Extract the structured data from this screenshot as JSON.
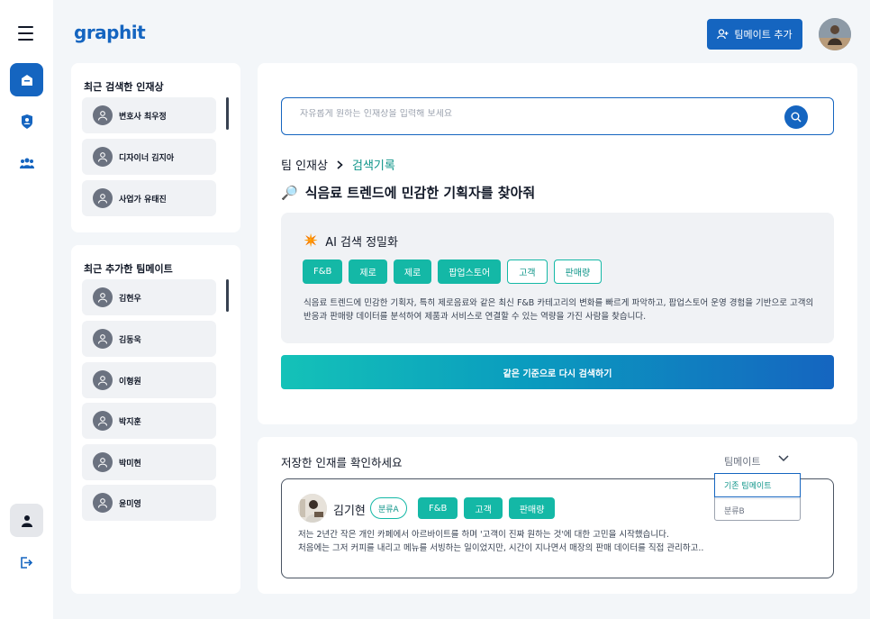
{
  "header": {
    "logo": "graphit",
    "add_teammate_label": "팀메이트 추가"
  },
  "sidebar": {
    "recent_searches_title": "최근 검색한 인재상",
    "recent_searches": [
      "변호사 최우정",
      "디자이너 김지아",
      "사업가 유태진"
    ],
    "recent_teammates_title": "최근 추가한 팀메이트",
    "recent_teammates": [
      "김현우",
      "김동욱",
      "이형원",
      "박지훈",
      "박미현",
      "윤미영"
    ]
  },
  "search": {
    "placeholder": "자유롭게 원하는 인재상을 입력해 보세요"
  },
  "breadcrumb": {
    "root": "팀 인재상",
    "current": "검색기록"
  },
  "query": {
    "emoji": "🔎",
    "text": "식음료 트렌드에 민감한 기획자를 찾아줘"
  },
  "ai_refine": {
    "emoji": "✴️",
    "title": "AI 검색 정밀화",
    "tags_solid": [
      "F&B",
      "제로",
      "제로",
      "팝업스토어"
    ],
    "tags_outline": [
      "고객",
      "판매량"
    ],
    "description": "식음료 트렌드에 민감한 기획자, 특히 제로음료와 같은 최신 F&B 카테고리의 변화를 빠르게 파악하고, 팝업스토어 운영 경험을 기반으로 고객의 반응과 판매량 데이터를 분석하여 제품과 서비스로 연결할 수 있는 역량을 가진 사람을 찾습니다."
  },
  "research_button_label": "같은 기준으로 다시 검색하기",
  "saved": {
    "title": "저장한 인재를 확인하세요",
    "dropdown_label": "팀메이트",
    "dropdown_options": [
      "기존 팀메이트",
      "분류B"
    ],
    "candidate": {
      "name": "김기현",
      "category": "분류A",
      "tags": [
        "F&B",
        "고객",
        "판매량"
      ],
      "description_line1": "저는 2년간 작은 개인 카페에서 아르바이트를 하며 '고객이 진짜 원하는 것'에 대한 고민을 시작했습니다.",
      "description_line2": "처음에는 그저 커피를 내리고 메뉴를 서빙하는 일이었지만, 시간이 지나면서 매장의 판매 데이터를 직접 관리하고.."
    }
  },
  "colors": {
    "primary": "#1565c0",
    "teal": "#14b8a6",
    "background": "#f3f6f9"
  }
}
